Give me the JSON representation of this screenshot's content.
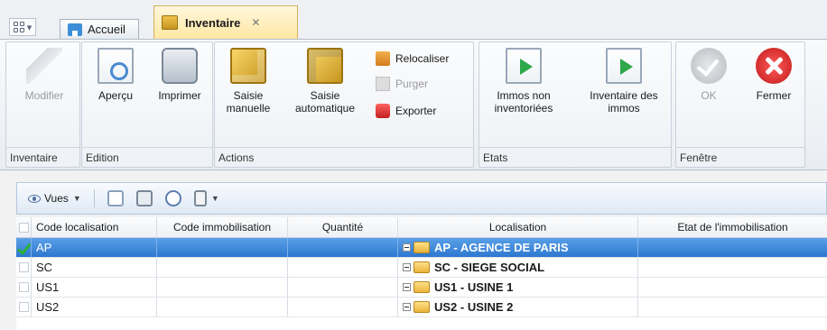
{
  "tabs": {
    "home_label": "Accueil",
    "active_label": "Inventaire",
    "close_glyph": "✕"
  },
  "ribbon": {
    "groups": [
      {
        "name": "inventaire",
        "label": "Inventaire"
      },
      {
        "name": "edition",
        "label": "Edition"
      },
      {
        "name": "actions",
        "label": "Actions"
      },
      {
        "name": "etats",
        "label": "Etats"
      },
      {
        "name": "fenetre",
        "label": "Fenêtre"
      }
    ],
    "buttons": {
      "modifier": "Modifier",
      "apercu": "Aperçu",
      "imprimer": "Imprimer",
      "saisie_manuelle": "Saisie\nmanuelle",
      "saisie_automatique": "Saisie\nautomatique",
      "relocaliser": "Relocaliser",
      "purger": "Purger",
      "exporter": "Exporter",
      "immos_non_inventoriees": "Immos non\ninventoriées",
      "inventaire_des_immos": "Inventaire des\nimmos",
      "ok": "OK",
      "fermer": "Fermer"
    },
    "icons": [
      "pencil-icon",
      "preview-icon",
      "printer-icon",
      "cube-pencil-icon",
      "cube-gear-icon",
      "house-arrow-icon",
      "purge-icon",
      "export-icon",
      "play-doc-icon",
      "ok-check-icon",
      "close-x-icon"
    ]
  },
  "grid_toolbar": {
    "vues_label": "Vues"
  },
  "table": {
    "columns": [
      "",
      "Code localisation",
      "Code immobilisation",
      "Quantité",
      "Localisation",
      "Etat de l'immobilisation"
    ],
    "rows": [
      {
        "code": "AP",
        "immo": "",
        "qty": "",
        "loc": "AP - AGENCE DE PARIS",
        "etat": "",
        "selected": true
      },
      {
        "code": "SC",
        "immo": "",
        "qty": "",
        "loc": "SC - SIEGE SOCIAL",
        "etat": "",
        "selected": false
      },
      {
        "code": "US1",
        "immo": "",
        "qty": "",
        "loc": "US1 - USINE 1",
        "etat": "",
        "selected": false
      },
      {
        "code": "US2",
        "immo": "",
        "qty": "",
        "loc": "US2 - USINE 2",
        "etat": "",
        "selected": false
      }
    ]
  },
  "colors": {
    "selected_row": "#3b86dc",
    "active_tab": "#ffe7a3",
    "ribbon_bg": "#eef1f5"
  }
}
